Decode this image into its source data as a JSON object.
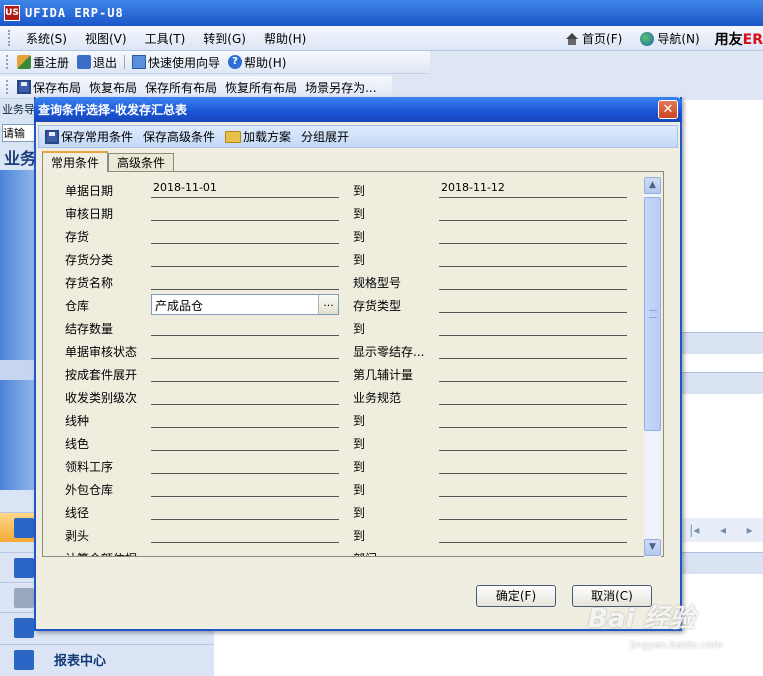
{
  "app": {
    "logo": "US",
    "title": "UFIDA ERP-U8"
  },
  "menubar": {
    "items": [
      {
        "label": "系统(S)"
      },
      {
        "label": "视图(V)"
      },
      {
        "label": "工具(T)"
      },
      {
        "label": "转到(G)"
      },
      {
        "label": "帮助(H)"
      }
    ],
    "right": {
      "home": "首页(F)",
      "nav": "导航(N)",
      "brand": "用友",
      "brand_suffix": "ER"
    }
  },
  "toolbar1": {
    "reregister": "重注册",
    "exit": "退出",
    "wizard": "快速使用向导",
    "help": "帮助(H)"
  },
  "toolbar2": {
    "save_layout": "保存布局",
    "restore_layout": "恢复布局",
    "save_all": "保存所有布局",
    "restore_all": "恢复所有布局",
    "save_scene": "场景另存为..."
  },
  "background": {
    "tab": "业务导",
    "input": "请输入",
    "heading": "业务",
    "report_center": "报表中心"
  },
  "dialog": {
    "title": "查询条件选择-收发存汇总表",
    "toolbar": {
      "save_common": "保存常用条件",
      "save_advanced": "保存高级条件",
      "load_scheme": "加载方案",
      "group_expand": "分组展开"
    },
    "tabs": [
      {
        "label": "常用条件"
      },
      {
        "label": "高级条件"
      }
    ],
    "fields": [
      {
        "label": "单据日期",
        "value": "2018-11-01",
        "to_label": "到",
        "to_value": "2018-11-12"
      },
      {
        "label": "审核日期",
        "value": "",
        "to_label": "到",
        "to_value": ""
      },
      {
        "label": "存货",
        "value": "",
        "to_label": "到",
        "to_value": ""
      },
      {
        "label": "存货分类",
        "value": "",
        "to_label": "到",
        "to_value": ""
      },
      {
        "label": "存货名称",
        "value": "",
        "to_label": "规格型号",
        "to_value": ""
      },
      {
        "label": "仓库",
        "value": "产成品仓",
        "to_label": "存货类型",
        "to_value": ""
      },
      {
        "label": "结存数量",
        "value": "",
        "to_label": "到",
        "to_value": ""
      },
      {
        "label": "单据审核状态",
        "value": "",
        "to_label": "显示零结存...",
        "to_value": ""
      },
      {
        "label": "按成套件展开",
        "value": "",
        "to_label": "第几辅计量",
        "to_value": ""
      },
      {
        "label": "收发类别级次",
        "value": "",
        "to_label": "业务规范",
        "to_value": ""
      },
      {
        "label": "线种",
        "value": "",
        "to_label": "到",
        "to_value": ""
      },
      {
        "label": "线色",
        "value": "",
        "to_label": "到",
        "to_value": ""
      },
      {
        "label": "领料工序",
        "value": "",
        "to_label": "到",
        "to_value": ""
      },
      {
        "label": "外包仓库",
        "value": "",
        "to_label": "到",
        "to_value": ""
      },
      {
        "label": "线径",
        "value": "",
        "to_label": "到",
        "to_value": ""
      },
      {
        "label": "剥头",
        "value": "",
        "to_label": "到",
        "to_value": ""
      },
      {
        "label": "计算金额依据",
        "value": "",
        "to_label": "部门",
        "to_value": ""
      }
    ],
    "browse_label": "...",
    "ok_label": "确定(F)",
    "cancel_label": "取消(C)"
  },
  "watermark": {
    "main": "Bai 经验",
    "sub": "jingyan.baidu.com"
  }
}
